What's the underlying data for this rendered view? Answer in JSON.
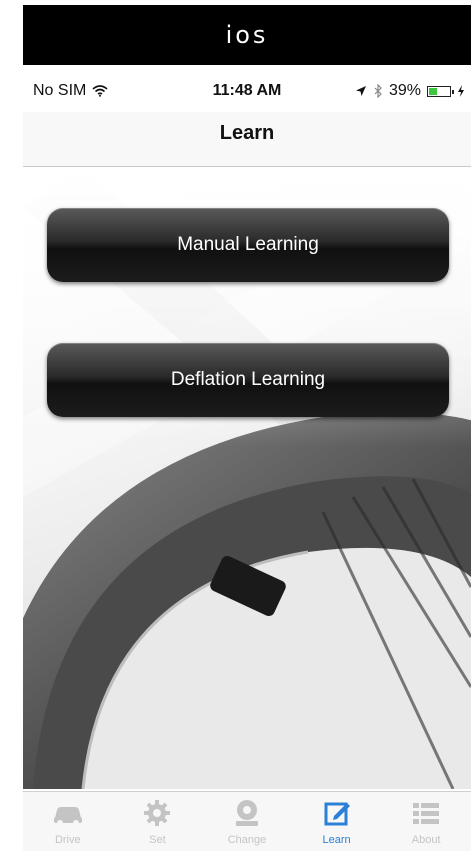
{
  "banner": {
    "text": "ios"
  },
  "status_bar": {
    "carrier": "No SIM",
    "time": "11:48 AM",
    "battery_percent": "39%",
    "battery_level": 0.39
  },
  "nav": {
    "title": "Learn"
  },
  "buttons": {
    "manual": "Manual Learning",
    "deflation": "Deflation Learning"
  },
  "tab_bar": {
    "active_color": "#2a80d6",
    "inactive_color": "#c4c4c4",
    "tabs": [
      {
        "label": "Drive",
        "icon": "car-icon",
        "active": false
      },
      {
        "label": "Set",
        "icon": "gear-icon",
        "active": false
      },
      {
        "label": "Change",
        "icon": "tire-change-icon",
        "active": false
      },
      {
        "label": "Learn",
        "icon": "edit-icon",
        "active": true
      },
      {
        "label": "About",
        "icon": "list-icon",
        "active": false
      }
    ]
  }
}
